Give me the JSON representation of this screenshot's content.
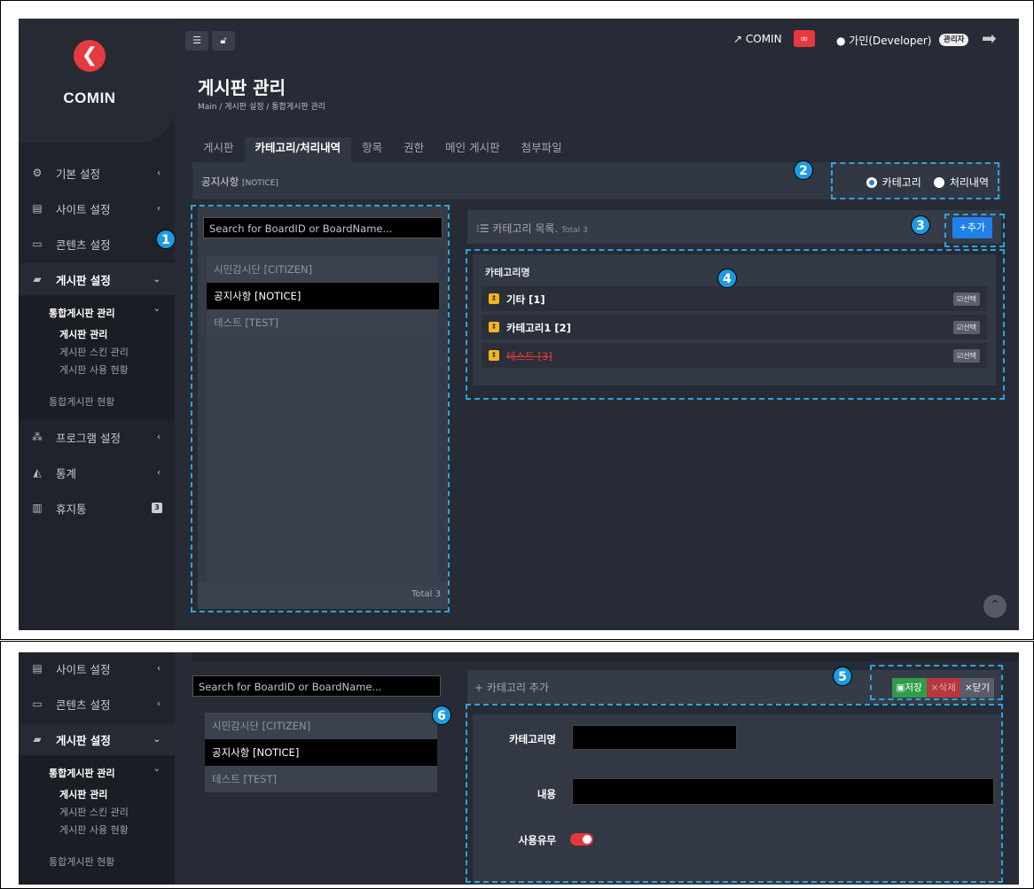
{
  "app": {
    "logo_text": "COMIN",
    "logo_glyph": "❮",
    "accent_color": "#1e80e9",
    "brand_color": "#e53a3f"
  },
  "topbar": {
    "site_link": "COMIN",
    "user_name": "가민(Developer)",
    "role_badge": "관리자"
  },
  "sidebar": {
    "items": [
      {
        "label": "기본 설정",
        "icon": "gears-icon"
      },
      {
        "label": "사이트 설정",
        "icon": "server-icon"
      },
      {
        "label": "콘텐츠 설정",
        "icon": "window-icon"
      },
      {
        "label": "게시판 설정",
        "icon": "comments-icon"
      },
      {
        "label": "프로그램 설정",
        "icon": "sitemap-icon"
      },
      {
        "label": "통계",
        "icon": "area-chart-icon"
      },
      {
        "label": "휴지통",
        "icon": "trash-icon",
        "badge": "3"
      }
    ],
    "sub": {
      "group": "통합게시판 관리",
      "children": [
        "게시판 관리",
        "게시판 스킨 관리",
        "게시판 사용 현황"
      ],
      "other": "통합게시판 현황"
    }
  },
  "page": {
    "title": "게시판 관리",
    "breadcrumb": "Main  /  게시판 설정  /  통합게시판 관리"
  },
  "tabs": [
    "게시판",
    "카테고리/처리내역",
    "항목",
    "권한",
    "메인 게시판",
    "첨부파일"
  ],
  "notice": {
    "title": "공지사항",
    "code": "[NOTICE]",
    "radio_category": "카테고리",
    "radio_history": "처리내역"
  },
  "board_panel": {
    "search_placeholder": "Search for BoardID or BoardName...",
    "boards": [
      "시민감시단 [CITIZEN]",
      "공지사항 [NOTICE]",
      "테스트 [TEST]"
    ],
    "total": "Total 3"
  },
  "category_panel": {
    "title": "카테고리 목록.",
    "total": "Total 3",
    "add_label": "+추가",
    "column": "카테고리명",
    "rows": [
      {
        "name": "기타 [1]",
        "select": "선택",
        "deleted": false
      },
      {
        "name": "카테고리1 [2]",
        "select": "선택",
        "deleted": false
      },
      {
        "name": "테스트 [3]",
        "select": "선택",
        "deleted": true
      }
    ]
  },
  "add_form": {
    "title": "+ 카테고리 추가",
    "save": "저장",
    "delete": "×삭제",
    "close": "×닫기",
    "name_label": "카테고리명",
    "content_label": "내용",
    "use_label": "사용유무",
    "name_value": "",
    "content_value": "",
    "use_enabled": true
  },
  "callouts": [
    "1",
    "2",
    "3",
    "4",
    "5",
    "6"
  ]
}
